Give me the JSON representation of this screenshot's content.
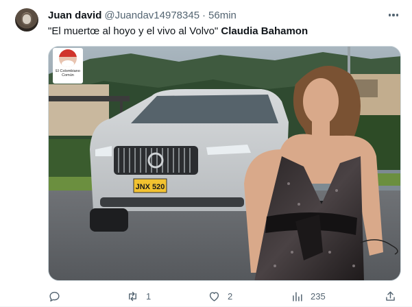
{
  "tweet": {
    "display_name": "Juan david",
    "handle": "@Juandav14978345",
    "separator": "·",
    "time": "56min",
    "text_quote": "\"El muertœ al hoyo y el vivo al Volvo\"",
    "text_mention": "Claudia Bahamon",
    "media": {
      "plate": "JNX 520",
      "badge_line1": "El Colombiano",
      "badge_line2": "Común"
    },
    "actions": {
      "reply_count": "",
      "retweet_count": "1",
      "like_count": "2",
      "views_count": "235"
    }
  },
  "icons": {
    "avatar": "avatar",
    "more": "more-icon",
    "reply": "reply-icon",
    "retweet": "retweet-icon",
    "like": "like-icon",
    "views": "views-icon",
    "share": "share-icon"
  },
  "colors": {
    "text": "#0f1419",
    "muted": "#536471",
    "border": "#cfd9de"
  }
}
